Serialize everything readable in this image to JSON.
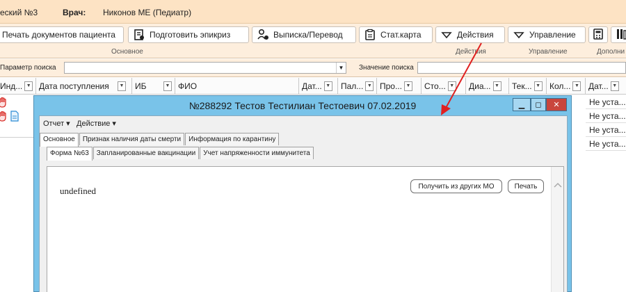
{
  "infobar": {
    "section": "еский №3",
    "doctor_label": "Врач:",
    "doctor_name": "Никонов МЕ (Педиатр)"
  },
  "ribbon": {
    "buttons": [
      {
        "label": "Печать документов пациента",
        "icon": "print-icon"
      },
      {
        "label": "Подготовить эпикриз",
        "icon": "prepare-document-icon"
      },
      {
        "label": "Выписка/Перевод",
        "icon": "discharge-transfer-icon"
      },
      {
        "label": "Стат.карта",
        "icon": "clipboard-icon"
      },
      {
        "label": "Действия",
        "icon": "chevron-down-icon"
      },
      {
        "label": "Управление",
        "icon": "chevron-down-icon"
      }
    ],
    "groups": [
      "Основное",
      "Действия",
      "Управление",
      "Дополни"
    ]
  },
  "search": {
    "param_label": "Параметр поиска",
    "value_label": "Значение поиска",
    "param_value": "",
    "value_value": ""
  },
  "grid": {
    "columns": [
      "Инд...",
      "Дата поступления",
      "ИБ",
      "ФИО",
      "Дат...",
      "Пал...",
      "Про...",
      "Сто...",
      "Диа...",
      "Тек...",
      "Кол...",
      "Дат..."
    ],
    "rows": [
      {
        "last_col": "Не уста..."
      },
      {
        "last_col": "Не уста..."
      },
      {
        "last_col": "Не уста..."
      },
      {
        "last_col": "Не уста..."
      }
    ]
  },
  "window": {
    "title": "№288292 Тестов Тестилиан Тестоевич 07.02.2019",
    "menu": [
      "Отчет ▾",
      "Действие ▾"
    ],
    "tabs": [
      "Основное",
      "Признак наличия даты смерти",
      "Информация по карантину"
    ],
    "subtabs": [
      "Форма №63",
      "Запланированные вакцинации",
      "Учет напряженности иммунитета"
    ],
    "content_text": "undefined",
    "btn_other": "Получить из других МО",
    "btn_print": "Печать"
  },
  "colors": {
    "infobar_bg": "#fde3c4",
    "ribbon_bg": "#fdeedd",
    "window_frame": "#79c3e9",
    "close_button": "#c9463d",
    "arrow": "#e02020"
  }
}
